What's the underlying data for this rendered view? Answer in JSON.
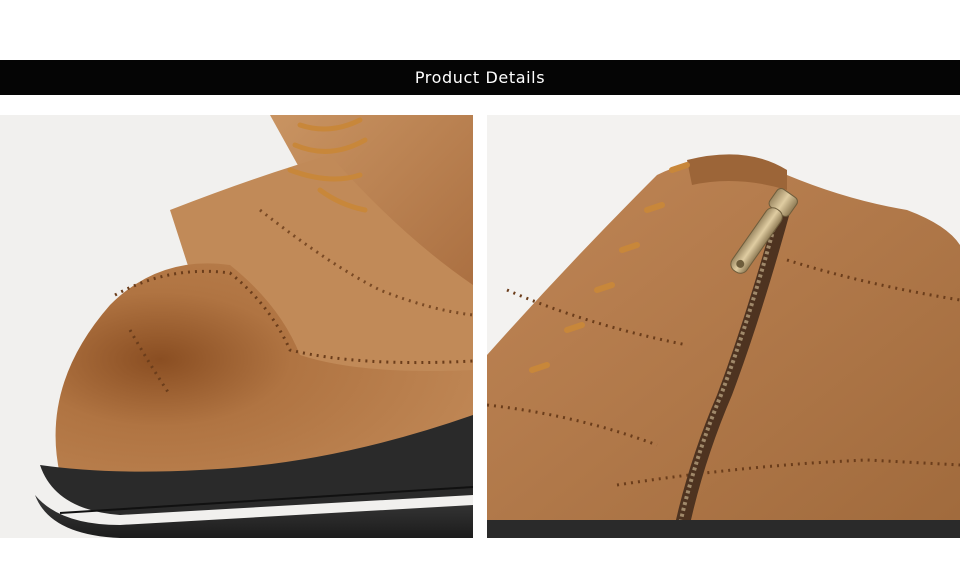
{
  "header": {
    "title": "Product Details",
    "background": "#050505",
    "text_color": "#ffffff"
  },
  "photos": [
    {
      "subject": "shoe-toe-closeup-photo"
    },
    {
      "subject": "boot-zipper-closeup-photo"
    }
  ],
  "colors": {
    "leather": "#b07848",
    "leather_dark": "#7a4a25",
    "sole": "#262626",
    "lace": "#c8873a",
    "zipper_pull": "#c9b48a"
  }
}
